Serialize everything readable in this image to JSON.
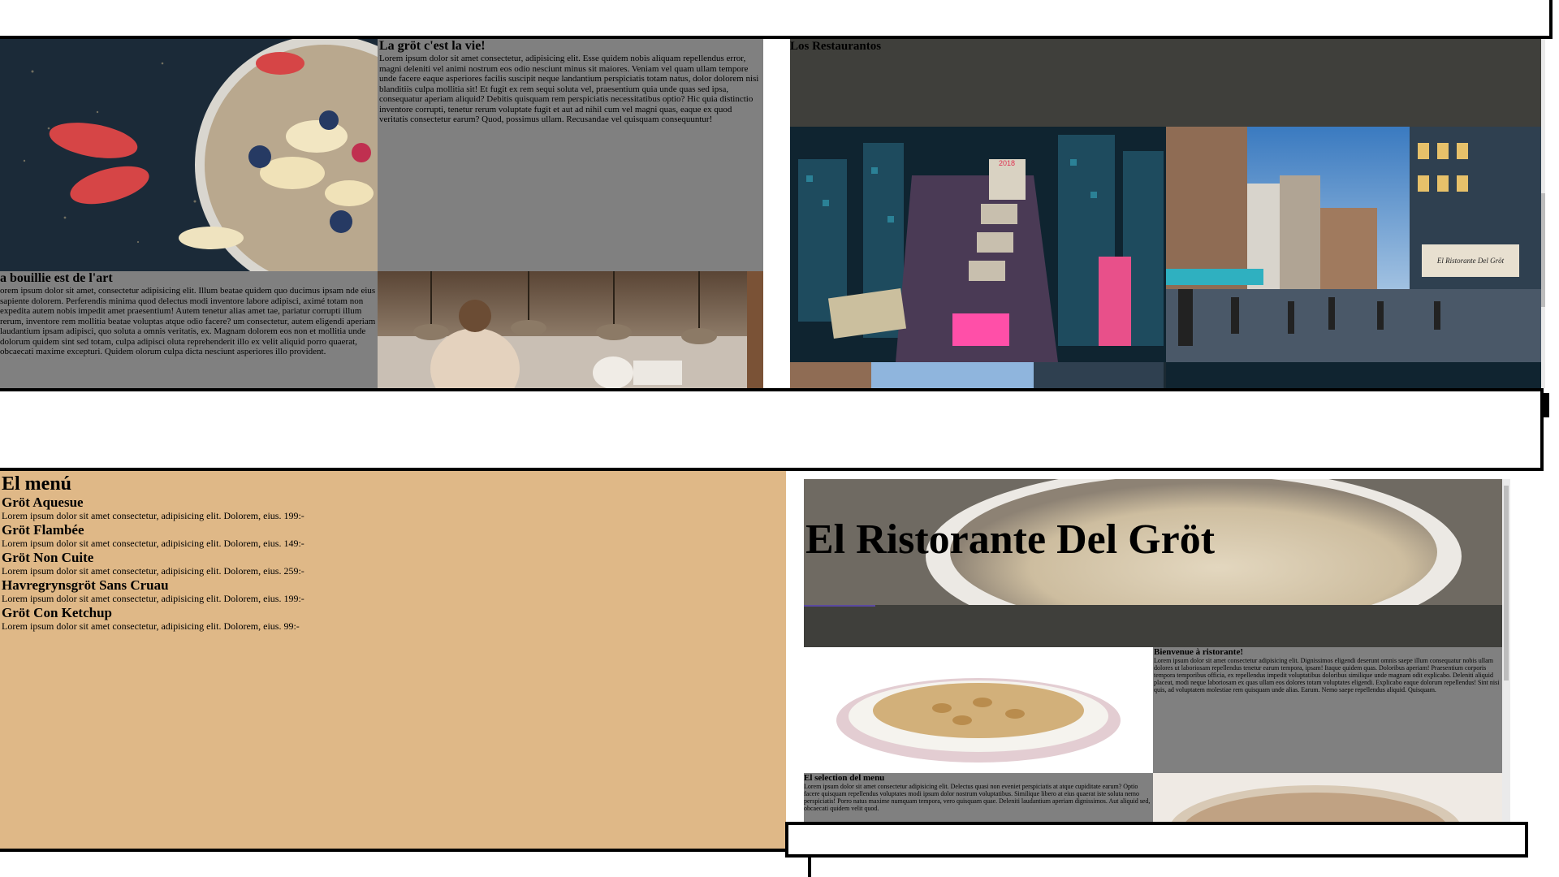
{
  "panel_top_left": {
    "article1": {
      "title": "La gröt c'est la vie!",
      "body": "Lorem ipsum dolor sit amet consectetur, adipisicing elit. Esse quidem nobis aliquam repellendus error, magni deleniti vel animi nostrum eos odio nesciunt minus sit maiores. Veniam vel quam ullam tempore unde facere eaque asperiores facilis suscipit neque landantium perspiciatis totam natus, dolor dolorem nisi blanditiis culpa mollitia sit! Et fugit ex rem sequi soluta vel, praesentium quia unde quas sed ipsa, consequatur aperiam aliquid? Debitis quisquam rem perspiciatis necessitatibus optio? Hic quia distinctio inventore corrupti, tenetur rerum voluptate fugit et aut ad nihil cum vel magni quas, eaque ex quod veritatis consectetur earum? Quod, possimus ullam. Recusandae vel quisquam consequuntur!"
    },
    "article2": {
      "title": "a bouillie est de l'art",
      "body": "orem ipsum dolor sit amet, consectetur adipisicing elit. Illum beatae quidem quo ducimus ipsam nde eius sapiente dolorem. Perferendis minima quod delectus modi inventore labore adipisci, aximé totam non expedita autem nobis impedit amet praesentium! Autem tenetur alias amet tae, pariatur corrupti illum rerum, inventore rem mollitia beatae voluptas atque odio facere? um consectetur, autem eligendi aperiam laudantium ipsam adipisci, quo soluta a omnis veritatis, ex. Magnam dolorem eos non et mollitia unde dolorum quidem sint sed totam, culpa adipisci oluta reprehenderit illo ex velit aliquid porro quaerat, obcaecati maxime excepturi. Quidem olorum culpa dicta nesciunt asperiores illo provident."
    }
  },
  "panel_top_right": {
    "title": "Los Restaurantos",
    "sign_text_1": "2018",
    "sign_text_2": "El Ristorante Del Gröt"
  },
  "panel_menu": {
    "title": "El menú",
    "items": [
      {
        "name": "Gröt Aquesue",
        "desc": "Lorem ipsum dolor sit amet consectetur, adipisicing elit. Dolorem, eius. 199:-"
      },
      {
        "name": "Gröt Flambée",
        "desc": "Lorem ipsum dolor sit amet consectetur, adipisicing elit. Dolorem, eius. 149:-"
      },
      {
        "name": "Gröt Non Cuite",
        "desc": "Lorem ipsum dolor sit amet consectetur, adipisicing elit. Dolorem, eius. 259:-"
      },
      {
        "name": "Havregrynsgröt Sans Cruau",
        "desc": "Lorem ipsum dolor sit amet consectetur, adipisicing elit. Dolorem, eius. 199:-"
      },
      {
        "name": "Gröt Con Ketchup",
        "desc": "Lorem ipsum dolor sit amet consectetur, adipisicing elit. Dolorem, eius. 99:-"
      }
    ]
  },
  "panel_home": {
    "hero_title": "El Ristorante Del Gröt",
    "welcome_title": "Bienvenue à ristorante!",
    "welcome_body": "Lorem ipsum dolor sit amet consectetur adipisicing elit. Dignissimos eligendi deserunt omnis saepe illum consequatur nobis ullam dolores ut laboriosam repellendus tenetur earum tempora, ipsam! Itaque quidem quas. Doloribus aperiam! Praesentium corporis tempora temporibus officia, ex repellendus impedit voluptatibus doloribus similique unde magnam odit explicabo. Deleniti aliquid placeat, modi neque laboriosam ex quas ullam eos dolores totam voluptates eligendi. Explicabo eaque dolorum repellendus! Sint nisi quis, ad voluptatem molestiae rem quisquam unde alias. Earum. Nemo saepe repellendus aliquid. Quisquam.",
    "selection_title": "El selection del menu",
    "selection_body": "Lorem ipsum dolor sit amet consectetur adipisicing elit. Delectus quasi non eveniet perspiciatis at atque cupiditate earum? Optio facere quisquam repellendus voluptates modi ipsum dolor nostrum voluptatibus. Similique libero at eius quaerat iste soluta nemo perspiciatis! Porro natus maxime numquam tempora, vero quisquam quae. Deleniti laudantium aperiam dignissimos. Aut aliquid sed, obcaecati quidem velit quod."
  },
  "colors": {
    "grey_panel": "#808080",
    "dark_panel": "#3f3f3b",
    "menu_bg": "#dfb887"
  }
}
